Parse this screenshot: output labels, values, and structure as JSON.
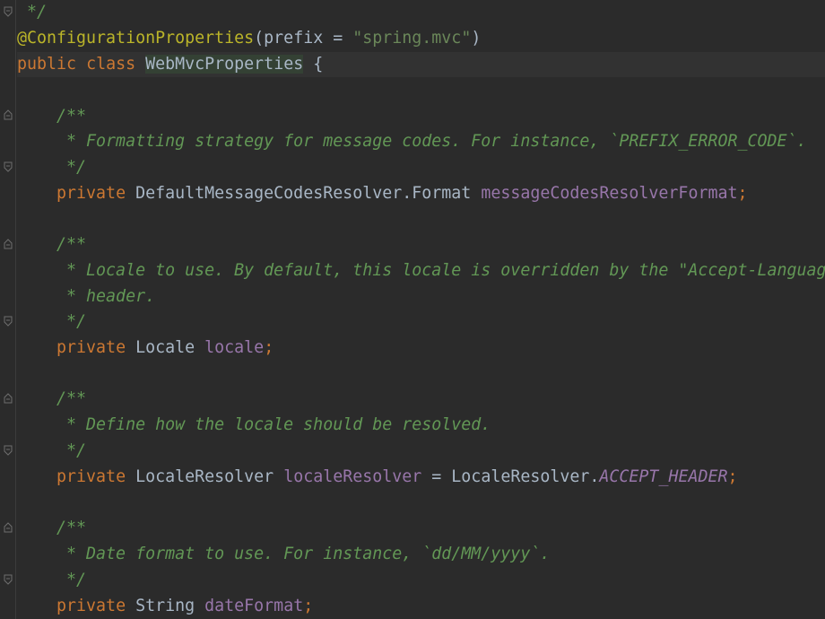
{
  "code": {
    "l1_close": " */",
    "l2_annotation": "@ConfigurationProperties",
    "l2_paren_open": "(",
    "l2_param": "prefix",
    "l2_eq": " = ",
    "l2_string": "\"spring.mvc\"",
    "l2_paren_close": ")",
    "l3_public": "public",
    "l3_class": "class",
    "l3_name": "WebMvcProperties",
    "l3_brace": " {",
    "c1_open": "    /**",
    "c1_text": "     * Formatting strategy for message codes. For instance, `PREFIX_ERROR_CODE`.",
    "c1_close": "     */",
    "f1_private": "private",
    "f1_type": " DefaultMessageCodesResolver.Format ",
    "f1_name": "messageCodesResolverFormat",
    "f1_semi": ";",
    "c2_open": "    /**",
    "c2_text1": "     * Locale to use. By default, this locale is overridden by the \"Accept-Language\"",
    "c2_text2": "     * header.",
    "c2_close": "     */",
    "f2_private": "private",
    "f2_type": " Locale ",
    "f2_name": "locale",
    "f2_semi": ";",
    "c3_open": "    /**",
    "c3_text": "     * Define how the locale should be resolved.",
    "c3_close": "     */",
    "f3_private": "private",
    "f3_type": " LocaleResolver ",
    "f3_name": "localeResolver",
    "f3_eq": " = LocaleResolver.",
    "f3_const": "ACCEPT_HEADER",
    "f3_semi": ";",
    "c4_open": "    /**",
    "c4_text": "     * Date format to use. For instance, `dd/MM/yyyy`.",
    "c4_close": "     */",
    "f4_private": "private",
    "f4_type": " String ",
    "f4_name": "dateFormat",
    "f4_semi": ";"
  },
  "indent": "    ",
  "colors": {
    "background": "#2b2b2b",
    "keyword": "#cc7832",
    "annotation": "#bbb529",
    "string": "#6a8759",
    "doc_comment": "#629755",
    "field": "#9876aa",
    "text": "#a9b7c6"
  },
  "icons": {
    "fold": "fold-marker-icon"
  }
}
